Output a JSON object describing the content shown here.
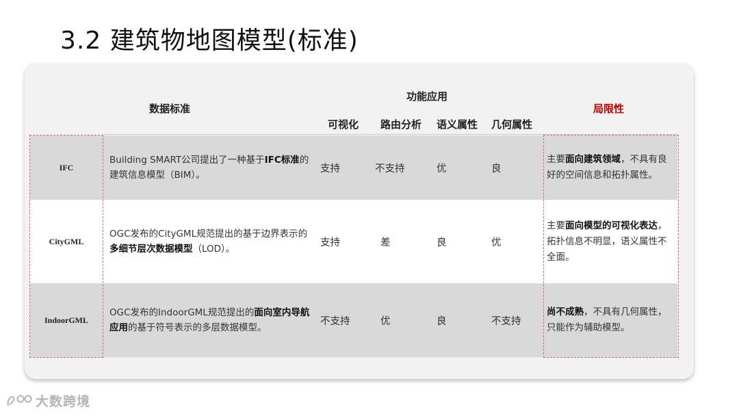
{
  "title": "3.2 建筑物地图模型(标准)",
  "headers": {
    "data_standard": "数据标准",
    "function_app": "功能应用",
    "visualization": "可视化",
    "route_analysis": "路由分析",
    "semantic_attr": "语义属性",
    "geometric_attr": "几何属性",
    "limitation": "局限性"
  },
  "rows": [
    {
      "name": "IFC",
      "desc_a": "Building SMART公司提出了一种基于",
      "desc_b": "IFC标准",
      "desc_c": "的建筑信息模型（BIM）。",
      "visualization": "支持",
      "route": "不支持",
      "semantic": "优",
      "geometric": "良",
      "lim_a": "主要",
      "lim_b": "面向建筑领域",
      "lim_c": "，不具有良好的空间信息和拓扑属性。"
    },
    {
      "name": "CityGML",
      "desc_a": "OGC发布的CityGML规范提出的基于边界表示的",
      "desc_b": "多细节层次数据模型",
      "desc_c": "（LOD）。",
      "visualization": "支持",
      "route": "差",
      "semantic": "良",
      "geometric": "优",
      "lim_a": "主要",
      "lim_b": "面向模型的可视化表达",
      "lim_c": "，拓扑信息不明显，语义属性不全面。"
    },
    {
      "name": "IndoorGML",
      "desc_a": "OGC发布的IndoorGML规范提出的",
      "desc_b": "面向室内导航应用",
      "desc_c": "的基于符号表示的多层数据模型。",
      "visualization": "不支持",
      "route": "优",
      "semantic": "良",
      "geometric": "不支持",
      "lim_a": "",
      "lim_b": "尚不成熟",
      "lim_c": "，不具有几何属性，只能作为辅助模型。"
    }
  ],
  "watermark": "大数跨境",
  "colors": {
    "limitation_header": "#c00000",
    "row_gray": "#d9d9d9",
    "dash": "#e06666"
  }
}
